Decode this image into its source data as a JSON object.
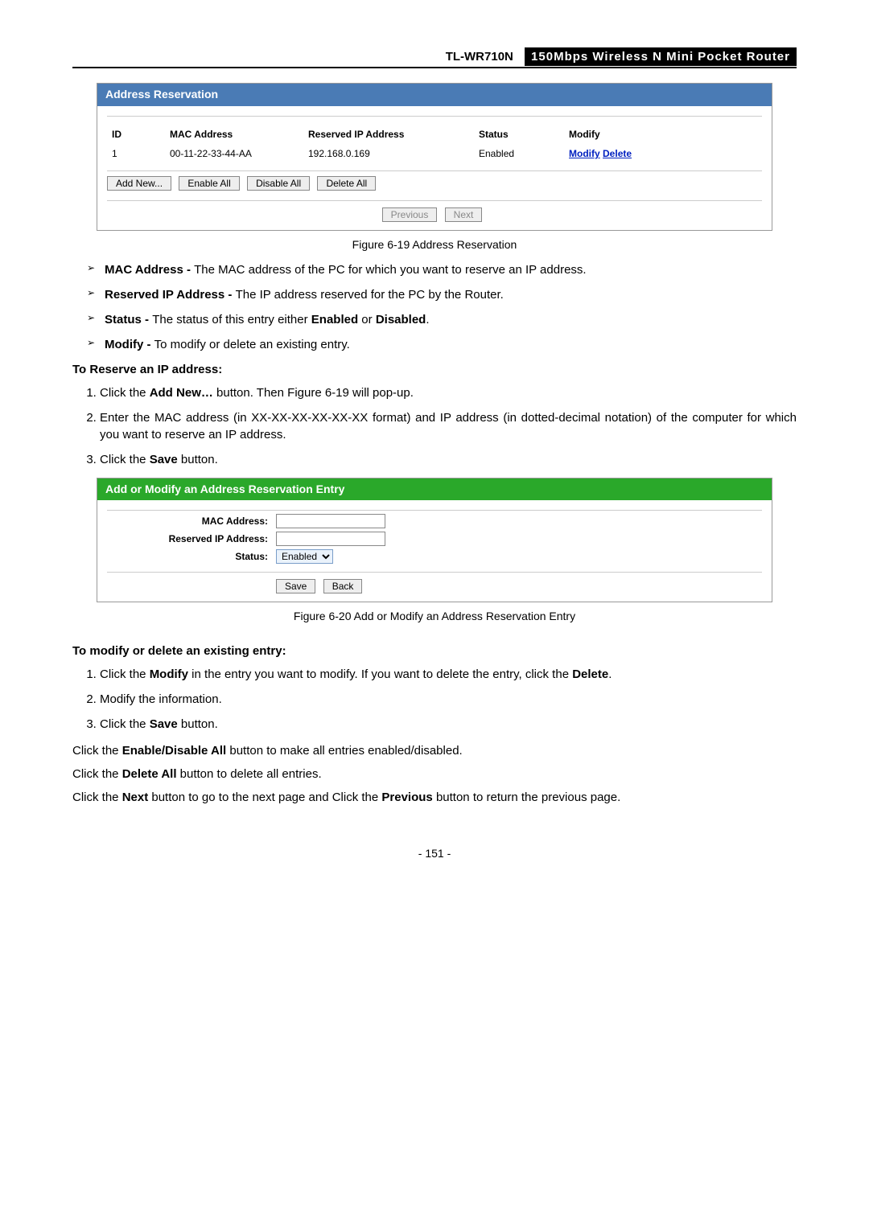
{
  "header": {
    "model": "TL-WR710N",
    "title": "150Mbps Wireless N Mini Pocket Router"
  },
  "figure1": {
    "title": "Address Reservation",
    "headers": {
      "id": "ID",
      "mac": "MAC Address",
      "ip": "Reserved IP Address",
      "status": "Status",
      "modify": "Modify"
    },
    "row": {
      "id": "1",
      "mac": "00-11-22-33-44-AA",
      "ip": "192.168.0.169",
      "status": "Enabled",
      "modify": "Modify",
      "delete": "Delete"
    },
    "buttons": {
      "addnew": "Add New...",
      "enableall": "Enable All",
      "disableall": "Disable All",
      "deleteall": "Delete All",
      "previous": "Previous",
      "next": "Next"
    },
    "caption": "Figure 6-19    Address Reservation"
  },
  "bullets": {
    "b1_term": "MAC Address - ",
    "b1_text": "The MAC address of the PC for which you want to reserve an IP address.",
    "b2_term": "Reserved IP Address - ",
    "b2_text": "The IP address reserved for the PC by the Router.",
    "b3_pre": "Status - ",
    "b3_mid": "The status of this entry either ",
    "b3_enabled": "Enabled",
    "b3_or": " or ",
    "b3_disabled": "Disabled",
    "b3_end": ".",
    "b4_term": "Modify - ",
    "b4_text": "To modify or delete an existing entry."
  },
  "heading_reserve": "To Reserve an IP address:",
  "steps_reserve": {
    "s1_pre": "Click the ",
    "s1_btn": "Add New…",
    "s1_post": " button. Then Figure 6-19 will pop-up.",
    "s2": "Enter the MAC address (in XX-XX-XX-XX-XX-XX format) and IP address (in dotted-decimal notation) of the computer for which you want to reserve an IP address.",
    "s3_pre": "Click the ",
    "s3_btn": "Save",
    "s3_post": " button."
  },
  "figure2": {
    "title": "Add or Modify an Address Reservation Entry",
    "labels": {
      "mac": "MAC Address:",
      "ip": "Reserved IP Address:",
      "status": "Status:"
    },
    "status_value": "Enabled",
    "buttons": {
      "save": "Save",
      "back": "Back"
    },
    "caption": "Figure 6-20    Add or Modify an Address Reservation Entry"
  },
  "heading_modify": "To modify or delete an existing entry:",
  "steps_modify": {
    "s1_pre": "Click the ",
    "s1_modify": "Modify",
    "s1_mid": " in the entry you want to modify. If you want to delete the entry, click the ",
    "s1_delete": "Delete",
    "s1_end": ".",
    "s2": "Modify the information.",
    "s3_pre": "Click the ",
    "s3_btn": "Save",
    "s3_post": " button."
  },
  "paras": {
    "p1_pre": "Click the ",
    "p1_b": "Enable/Disable All",
    "p1_post": " button to make all entries enabled/disabled.",
    "p2_pre": "Click the ",
    "p2_b": "Delete All",
    "p2_post": " button to delete all entries.",
    "p3_pre": "Click the ",
    "p3_next": "Next",
    "p3_mid": " button to go to the next page and Click the ",
    "p3_prev": "Previous",
    "p3_post": " button to return the previous page."
  },
  "page_number": "- 151 -"
}
